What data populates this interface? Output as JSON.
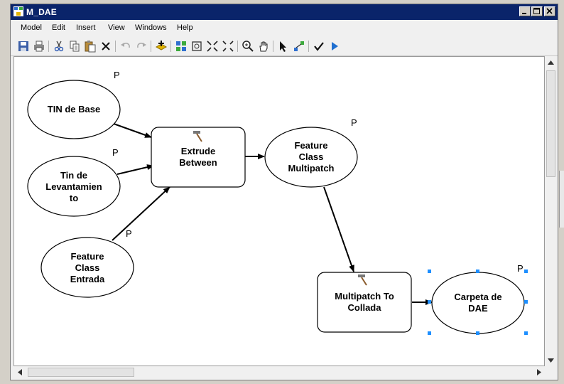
{
  "window": {
    "title": "M_DAE"
  },
  "menu": {
    "items": [
      "Model",
      "Edit",
      "Insert",
      "View",
      "Windows",
      "Help"
    ]
  },
  "toolbar": {
    "icons": [
      "save-icon",
      "print-icon",
      "cut-icon",
      "copy-icon",
      "paste-icon",
      "delete-icon",
      "undo-icon",
      "redo-icon",
      "add-data-icon",
      "auto-layout-icon",
      "full-extent-icon",
      "zoom-in-fixed-icon",
      "zoom-out-fixed-icon",
      "zoom-icon",
      "pan-icon",
      "select-icon",
      "connect-icon",
      "validate-icon",
      "run-icon"
    ]
  },
  "diagram": {
    "nodes": {
      "tin_base": {
        "lines": [
          "TIN de Base"
        ],
        "param": "P"
      },
      "tin_levantamiento": {
        "lines": [
          "Tin de",
          "Levantamien",
          "to"
        ],
        "param": "P"
      },
      "feature_class_entrada": {
        "lines": [
          "Feature",
          "Class",
          "Entrada"
        ],
        "param": "P"
      },
      "extrude_between": {
        "lines": [
          "Extrude",
          "Between"
        ]
      },
      "feature_class_multipatch": {
        "lines": [
          "Feature",
          "Class",
          "Multipatch"
        ],
        "param": "P"
      },
      "multipatch_to_collada": {
        "lines": [
          "Multipatch To",
          "Collada"
        ]
      },
      "carpeta_dae": {
        "lines": [
          "Carpeta de",
          "DAE"
        ],
        "param": "P"
      }
    }
  },
  "colors": {
    "title_bar": "#0a246a",
    "selection_handle": "#1e8fff",
    "canvas": "#ffffff"
  }
}
